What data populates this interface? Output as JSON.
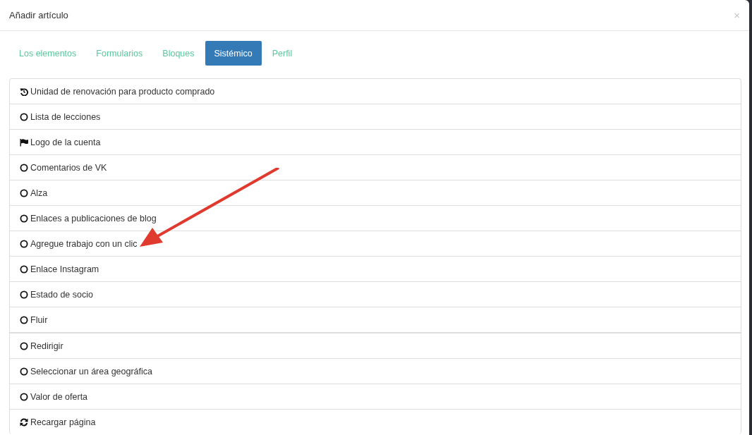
{
  "window": {
    "title": "Añadir artículo",
    "close": "×"
  },
  "tabs": [
    {
      "label": "Los elementos",
      "selected": false
    },
    {
      "label": "Formularios",
      "selected": false
    },
    {
      "label": "Bloques",
      "selected": false
    },
    {
      "label": "Sistémico",
      "selected": true
    },
    {
      "label": "Perfil",
      "selected": false
    }
  ],
  "items": [
    {
      "kind": "history",
      "label": "Unidad de renovación para producto comprado"
    },
    {
      "kind": "circle",
      "label": "Lista de lecciones"
    },
    {
      "kind": "flag",
      "label": "Logo de la cuenta"
    },
    {
      "kind": "circle",
      "label": "Comentarios de VK"
    },
    {
      "kind": "circle",
      "label": "Alza"
    },
    {
      "kind": "circle",
      "label": "Enlaces a publicaciones de blog"
    },
    {
      "kind": "circle",
      "label": "Agregue trabajo con un clic"
    },
    {
      "kind": "circle",
      "label": "Enlace Instagram"
    },
    {
      "kind": "circle",
      "label": "Estado de socio"
    },
    {
      "kind": "circle",
      "label": "Fluir"
    },
    {
      "kind": "circle",
      "label": "Redirigir"
    },
    {
      "kind": "circle",
      "label": "Seleccionar un área geográfica"
    },
    {
      "kind": "circle",
      "label": "Valor de oferta"
    },
    {
      "kind": "refresh",
      "label": "Recargar página"
    }
  ]
}
